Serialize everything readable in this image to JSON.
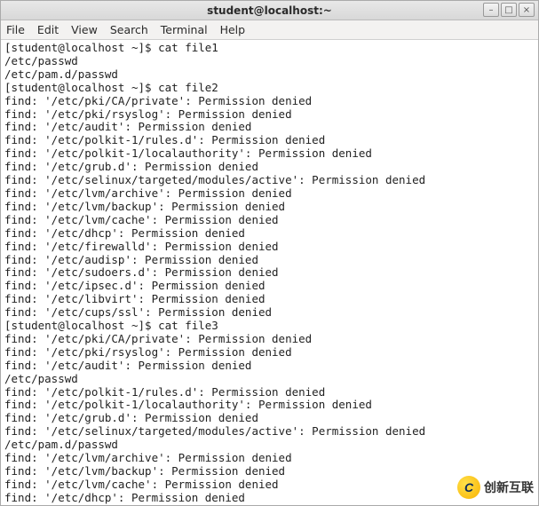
{
  "window": {
    "title": "student@localhost:~",
    "controls": {
      "minimize_glyph": "–",
      "maximize_glyph": "□",
      "close_glyph": "×"
    }
  },
  "menubar": {
    "items": [
      "File",
      "Edit",
      "View",
      "Search",
      "Terminal",
      "Help"
    ]
  },
  "terminal": {
    "lines": [
      "[student@localhost ~]$ cat file1",
      "/etc/passwd",
      "/etc/pam.d/passwd",
      "[student@localhost ~]$ cat file2",
      "find: '/etc/pki/CA/private': Permission denied",
      "find: '/etc/pki/rsyslog': Permission denied",
      "find: '/etc/audit': Permission denied",
      "find: '/etc/polkit-1/rules.d': Permission denied",
      "find: '/etc/polkit-1/localauthority': Permission denied",
      "find: '/etc/grub.d': Permission denied",
      "find: '/etc/selinux/targeted/modules/active': Permission denied",
      "find: '/etc/lvm/archive': Permission denied",
      "find: '/etc/lvm/backup': Permission denied",
      "find: '/etc/lvm/cache': Permission denied",
      "find: '/etc/dhcp': Permission denied",
      "find: '/etc/firewalld': Permission denied",
      "find: '/etc/audisp': Permission denied",
      "find: '/etc/sudoers.d': Permission denied",
      "find: '/etc/ipsec.d': Permission denied",
      "find: '/etc/libvirt': Permission denied",
      "find: '/etc/cups/ssl': Permission denied",
      "[student@localhost ~]$ cat file3",
      "find: '/etc/pki/CA/private': Permission denied",
      "find: '/etc/pki/rsyslog': Permission denied",
      "find: '/etc/audit': Permission denied",
      "/etc/passwd",
      "find: '/etc/polkit-1/rules.d': Permission denied",
      "find: '/etc/polkit-1/localauthority': Permission denied",
      "find: '/etc/grub.d': Permission denied",
      "find: '/etc/selinux/targeted/modules/active': Permission denied",
      "/etc/pam.d/passwd",
      "find: '/etc/lvm/archive': Permission denied",
      "find: '/etc/lvm/backup': Permission denied",
      "find: '/etc/lvm/cache': Permission denied",
      "find: '/etc/dhcp': Permission denied"
    ]
  },
  "watermark": {
    "logo_letter": "C",
    "text": "创新互联"
  }
}
